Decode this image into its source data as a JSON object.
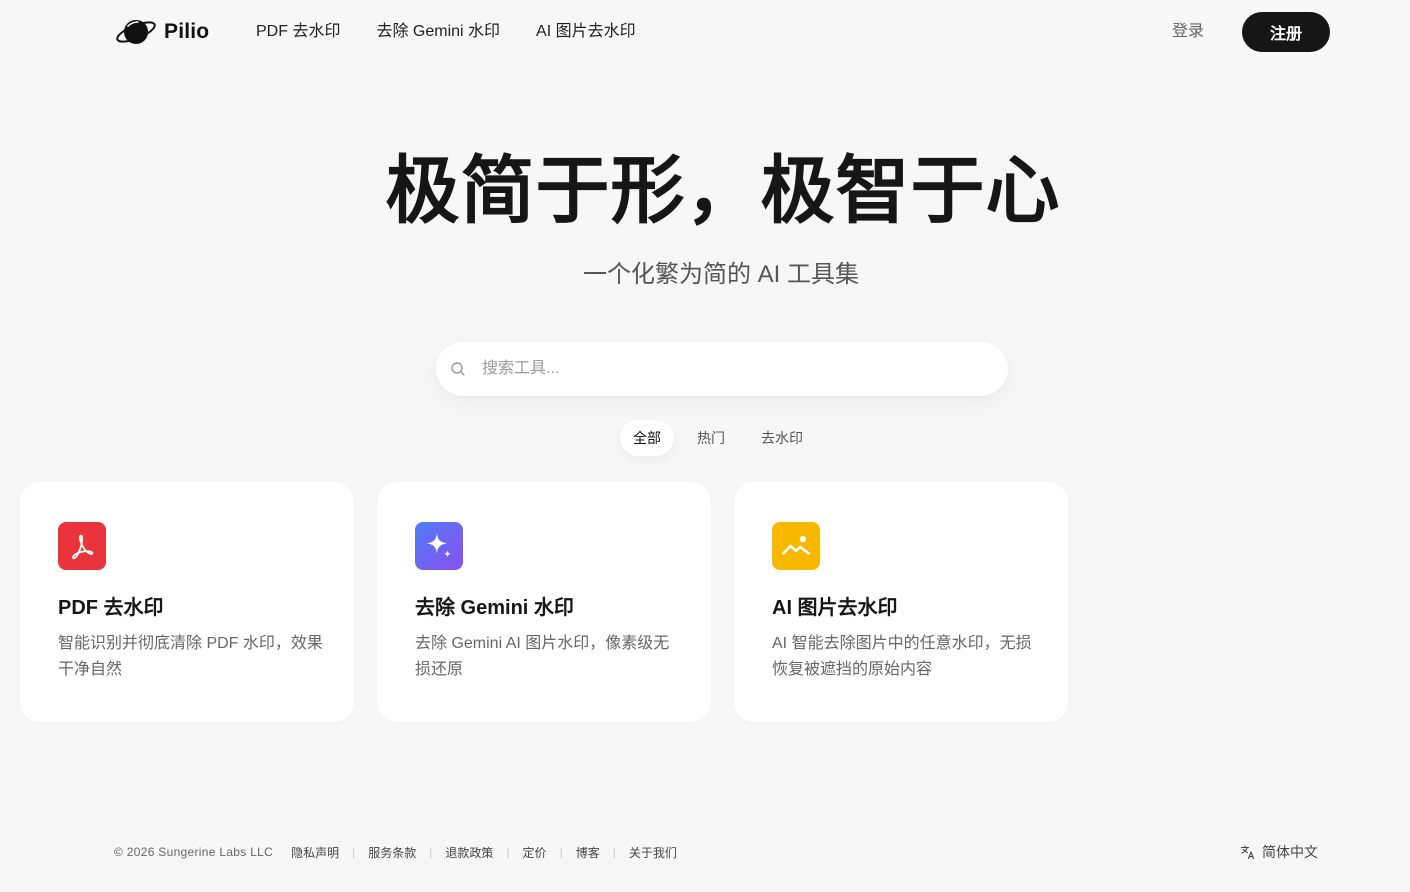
{
  "brand": {
    "name": "Pilio"
  },
  "nav": [
    {
      "label": "PDF 去水印"
    },
    {
      "label": "去除 Gemini 水印"
    },
    {
      "label": "AI 图片去水印"
    }
  ],
  "auth": {
    "login": "登录",
    "signup": "注册"
  },
  "hero": {
    "title": "极简于形，极智于心",
    "subtitle": "一个化繁为简的 AI 工具集"
  },
  "search": {
    "placeholder": "搜索工具...",
    "value": ""
  },
  "tabs": [
    {
      "label": "全部",
      "active": true
    },
    {
      "label": "热门",
      "active": false
    },
    {
      "label": "去水印",
      "active": false
    }
  ],
  "cards": [
    {
      "title": "PDF 去水印",
      "description": "智能识别并彻底清除 PDF 水印，效果干净自然",
      "icon": "pdf-acrobat-icon",
      "color": "#e8343a"
    },
    {
      "title": "去除 Gemini 水印",
      "description": "去除 Gemini AI 图片水印，像素级无损还原",
      "icon": "sparkle-icon",
      "color": "#6b5cf0"
    },
    {
      "title": "AI 图片去水印",
      "description": "AI 智能去除图片中的任意水印，无损恢复被遮挡的原始内容",
      "icon": "image-icon",
      "color": "#f9b800"
    }
  ],
  "footer": {
    "copyright": "© 2026 Sungerine Labs LLC",
    "links": [
      "隐私声明",
      "服务条款",
      "退款政策",
      "定价",
      "博客",
      "关于我们"
    ],
    "language": "简体中文"
  },
  "colors": {
    "background": "#f7f7f7",
    "primary": "#161616",
    "card": "#ffffff"
  }
}
